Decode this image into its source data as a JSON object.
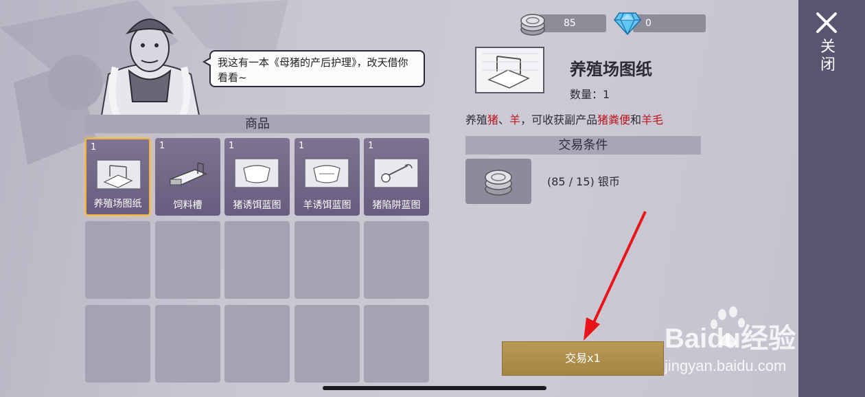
{
  "currency": {
    "coins": "85",
    "gems": "0"
  },
  "npc": {
    "speech": "我这有一本《母猪的产后护理》，改天借你看看~"
  },
  "shop": {
    "section_title": "商品",
    "items": [
      {
        "qty": "1",
        "label": "养殖场图纸",
        "selected": true
      },
      {
        "qty": "1",
        "label": "饲料槽",
        "selected": false
      },
      {
        "qty": "1",
        "label": "猪诱饵蓝图",
        "selected": false
      },
      {
        "qty": "1",
        "label": "羊诱饵蓝图",
        "selected": false
      },
      {
        "qty": "1",
        "label": "猪陷阱蓝图",
        "selected": false
      }
    ]
  },
  "detail": {
    "title": "养殖场图纸",
    "quantity": "数量：1",
    "desc_parts": [
      "养殖",
      "猪",
      "、",
      "羊",
      "，可收获副产品",
      "猪粪便",
      "和",
      "羊毛"
    ],
    "trade_section": "交易条件",
    "requirement": "(85 / 15) 银币",
    "trade_button": "交易x1"
  },
  "side": {
    "close_label": "关闭"
  },
  "watermark": {
    "brand": "Baidu经验",
    "url": "jingyan.baidu.com"
  },
  "colors": {
    "selected_border": "#f1b43a",
    "highlight_text": "#b9171c",
    "trade_button": "#b19250",
    "side_panel": "#5b5470"
  }
}
